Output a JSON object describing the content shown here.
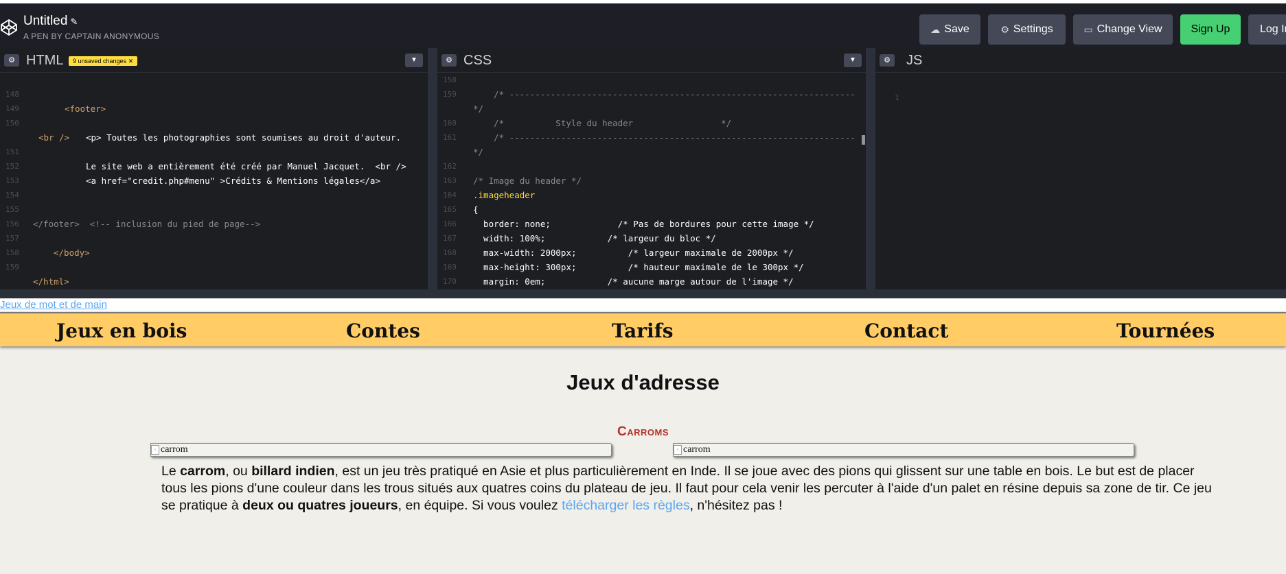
{
  "header": {
    "title": "Untitled",
    "subtitle": "A PEN BY CAPTAIN ANONYMOUS",
    "buttons": {
      "save": "Save",
      "settings": "Settings",
      "change_view": "Change View",
      "sign_up": "Sign Up",
      "log_in": "Log In"
    }
  },
  "panes": {
    "html": {
      "title": "HTML",
      "badge": "9 unsaved changes",
      "lines": [
        {
          "n": "148",
          "code": "<footer>"
        },
        {
          "n": "149",
          "code": ""
        },
        {
          "n": "150",
          "code": "<p> Toutes les photographies sont soumises au droit d'auteur."
        },
        {
          "n": "",
          "code": "<br />"
        },
        {
          "n": "151",
          "code": "Le site web a entièrement été créé par Manuel Jacquet.  <br />"
        },
        {
          "n": "152",
          "code": "<a href=\"credit.php#menu\" >Crédits & Mentions légales</a>"
        },
        {
          "n": "153",
          "code": ""
        },
        {
          "n": "154",
          "code": ""
        },
        {
          "n": "155",
          "code": "</footer>  <!-- inclusion du pied de page-->"
        },
        {
          "n": "156",
          "code": ""
        },
        {
          "n": "157",
          "code": "</body>"
        },
        {
          "n": "158",
          "code": ""
        },
        {
          "n": "159",
          "code": "</html>"
        }
      ]
    },
    "css": {
      "title": "CSS",
      "lines": [
        {
          "n": "158",
          "code": ""
        },
        {
          "n": "159",
          "code": "/* -------------------------------------------------------------------"
        },
        {
          "n": "",
          "code": "*/"
        },
        {
          "n": "160",
          "code": "/*          Style du header                 */"
        },
        {
          "n": "161",
          "code": "/* -------------------------------------------------------------------"
        },
        {
          "n": "",
          "code": "*/"
        },
        {
          "n": "162",
          "code": ""
        },
        {
          "n": "163",
          "code": "/* Image du header */"
        },
        {
          "n": "164",
          "code": ".imageheader"
        },
        {
          "n": "165",
          "code": "{"
        },
        {
          "n": "166",
          "code": "  border: none;             /* Pas de bordures pour cette image */"
        },
        {
          "n": "167",
          "code": "  width: 100%;            /* largeur du bloc */"
        },
        {
          "n": "168",
          "code": "  max-width: 2000px;          /* largeur maximale de 2000px */"
        },
        {
          "n": "169",
          "code": "  max-height: 300px;          /* hauteur maximale de le 300px */"
        },
        {
          "n": "170",
          "code": "  margin: 0em;            /* aucune marge autour de l'image */"
        }
      ]
    },
    "js": {
      "title": "JS",
      "line_number": "1"
    }
  },
  "preview": {
    "skip_link": "Jeux de mot et de main",
    "nav": [
      "Jeux en bois",
      "Contes",
      "Tarifs",
      "Contact",
      "Tournées"
    ],
    "heading": "Jeux d'adresse",
    "subheading": "Carroms",
    "image_alt": "carrom",
    "paragraph": {
      "t1": "Le ",
      "b1": "carrom",
      "t2": ", ou ",
      "b2": "billard indien",
      "t3": ", est un jeu très pratiqué en Asie et plus particulièrement en Inde. Il se joue avec des pions qui glissent sur une table en bois. Le but est de placer tous les pions d'une couleur dans les trous situés aux quatres coins du plateau de jeu. Il faut pour cela venir les percuter à l'aide d'un palet en résine depuis sa zone de tir. Ce jeu se pratique à ",
      "b3": "deux ou quatres joueurs",
      "t4": ", en équipe. Si vous voulez ",
      "link": "télécharger les règles",
      "t5": ", n'hésitez pas !"
    }
  },
  "colors": {
    "topbar": "#1e1f26",
    "editor_bg": "#1d1e22",
    "button": "#444857",
    "signup_green": "#47cf73",
    "badge_yellow": "#ffdd40",
    "nav_bg": "#ffcc66",
    "heading_red": "#b5332a",
    "link_blue": "#5aa7f0"
  }
}
